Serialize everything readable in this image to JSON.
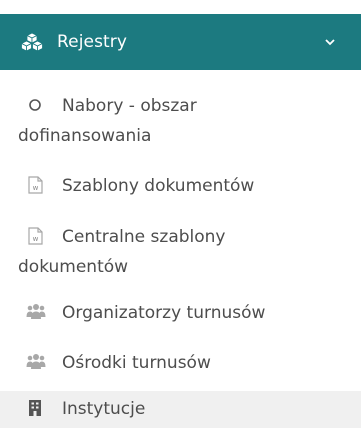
{
  "section": {
    "title": "Rejestry",
    "icon": "cubes-icon",
    "expanded_icon": "chevron-down-icon",
    "bg_color": "#1c7a80",
    "text_color": "#ffffff"
  },
  "items": [
    {
      "label_line1": "Nabory - obszar",
      "label_line2": "dofinansowania",
      "icon": "circle-outline-icon"
    },
    {
      "label_line1": "Szablony dokumentów",
      "icon": "word-document-icon"
    },
    {
      "label_line1": "Centralne szablony",
      "label_line2": "dokumentów",
      "icon": "word-document-icon"
    },
    {
      "label_line1": "Organizatorzy turnusów",
      "icon": "users-icon"
    },
    {
      "label_line1": "Ośrodki turnusów",
      "icon": "users-icon"
    },
    {
      "label_line1": "Instytucje",
      "icon": "building-icon"
    }
  ],
  "colors": {
    "item_text": "#4d4d4d",
    "icon_gray": "#a8a8a8",
    "hover_bg": "#f0f0f0"
  }
}
